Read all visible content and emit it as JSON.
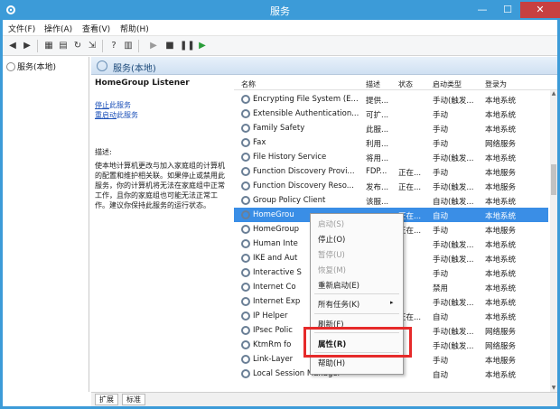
{
  "window": {
    "title": "服务",
    "minimize": "—",
    "maximize": "☐",
    "close": "✕"
  },
  "menu": [
    "文件(F)",
    "操作(A)",
    "查看(V)",
    "帮助(H)"
  ],
  "toolbar_icons": [
    "back-icon",
    "forward-icon",
    "console-tree-icon",
    "properties-view-icon",
    "refresh-icon",
    "export-icon",
    "help-icon",
    "details-icon",
    "play-icon",
    "stop-icon",
    "pause-icon",
    "restart-icon"
  ],
  "tree": {
    "item": "服务(本地)"
  },
  "main": {
    "header": "服务(本地)",
    "selected_title": "HomeGroup Listener",
    "stop_link": "停止",
    "stop_suffix": "此服务",
    "restart_link": "重启动",
    "restart_suffix": "此服务",
    "desc_label": "描述:",
    "desc_text": "使本地计算机更改与加入家庭组的计算机的配置和维护相关联。如果停止或禁用此服务，你的计算机将无法在家庭组中正常工作，且你的家庭组也可能无法正常工作。建议你保持此服务的运行状态。"
  },
  "columns": [
    "名称",
    "描述",
    "状态",
    "启动类型",
    "登录为"
  ],
  "rows": [
    {
      "name": "Encrypting File System (E...",
      "desc": "提供...",
      "status": "",
      "startup": "手动(触发...",
      "logon": "本地系统"
    },
    {
      "name": "Extensible Authentication...",
      "desc": "可扩...",
      "status": "",
      "startup": "手动",
      "logon": "本地系统"
    },
    {
      "name": "Family Safety",
      "desc": "此服...",
      "status": "",
      "startup": "手动",
      "logon": "本地系统"
    },
    {
      "name": "Fax",
      "desc": "利用...",
      "status": "",
      "startup": "手动",
      "logon": "网络服务"
    },
    {
      "name": "File History Service",
      "desc": "将用...",
      "status": "",
      "startup": "手动(触发...",
      "logon": "本地系统"
    },
    {
      "name": "Function Discovery Provi...",
      "desc": "FDP...",
      "status": "正在...",
      "startup": "手动",
      "logon": "本地服务"
    },
    {
      "name": "Function Discovery Reso...",
      "desc": "发布...",
      "status": "正在...",
      "startup": "手动(触发...",
      "logon": "本地服务"
    },
    {
      "name": "Group Policy Client",
      "desc": "该服...",
      "status": "",
      "startup": "自动(触发...",
      "logon": "本地系统"
    },
    {
      "name": "HomeGroup Listener",
      "desc": "",
      "status": "正在...",
      "startup": "自动",
      "logon": "本地系统"
    },
    {
      "name": "HomeGroup Provider",
      "desc": "",
      "status": "正在...",
      "startup": "手动",
      "logon": "本地服务"
    },
    {
      "name": "Human Interface Device...",
      "desc": "",
      "status": "",
      "startup": "手动(触发...",
      "logon": "本地系统"
    },
    {
      "name": "IKE and AuthIP",
      "desc": "",
      "status": "",
      "startup": "手动(触发...",
      "logon": "本地系统"
    },
    {
      "name": "Interactive Services",
      "desc": "",
      "status": "",
      "startup": "手动",
      "logon": "本地系统"
    },
    {
      "name": "Internet Connection",
      "desc": "",
      "status": "",
      "startup": "禁用",
      "logon": "本地系统"
    },
    {
      "name": "Internet Explorer",
      "desc": "",
      "status": "",
      "startup": "手动(触发...",
      "logon": "本地系统"
    },
    {
      "name": "IP Helper",
      "desc": "",
      "status": "正在...",
      "startup": "自动",
      "logon": "本地系统"
    },
    {
      "name": "IPsec Policy Agent",
      "desc": "",
      "status": "",
      "startup": "手动(触发...",
      "logon": "网络服务"
    },
    {
      "name": "KtmRm for Distributed",
      "desc": "",
      "status": "",
      "startup": "手动(触发...",
      "logon": "网络服务"
    },
    {
      "name": "Link-Layer Topology",
      "desc": "",
      "status": "",
      "startup": "手动",
      "logon": "本地服务"
    },
    {
      "name": "Local Session Manager",
      "desc": "",
      "status": "",
      "startup": "自动",
      "logon": "本地系统"
    }
  ],
  "display_names": [
    "Encrypting File System (E...",
    "Extensible Authentication...",
    "Family Safety",
    "Fax",
    "File History Service",
    "Function Discovery Provi...",
    "Function Discovery Reso...",
    "Group Policy Client",
    "HomeGrou",
    "HomeGroup",
    "Human Inte",
    "IKE and Aut",
    "Interactive S",
    "Internet Co",
    "Internet Exp",
    "IP Helper",
    "IPsec Polic",
    "KtmRm fo",
    "Link-Layer",
    "Local Session Manager"
  ],
  "context_menu": {
    "items": [
      "启动(S)",
      "停止(O)",
      "暂停(U)",
      "恢复(M)",
      "重新启动(E)",
      "所有任务(K)",
      "刷新(F)",
      "属性(R)",
      "帮助(H)"
    ],
    "submenu_arrow": "▸"
  },
  "bottom_tabs": [
    "扩展",
    "标准"
  ],
  "accent": "#3c9bd8",
  "highlight_color": "#e62a2a"
}
